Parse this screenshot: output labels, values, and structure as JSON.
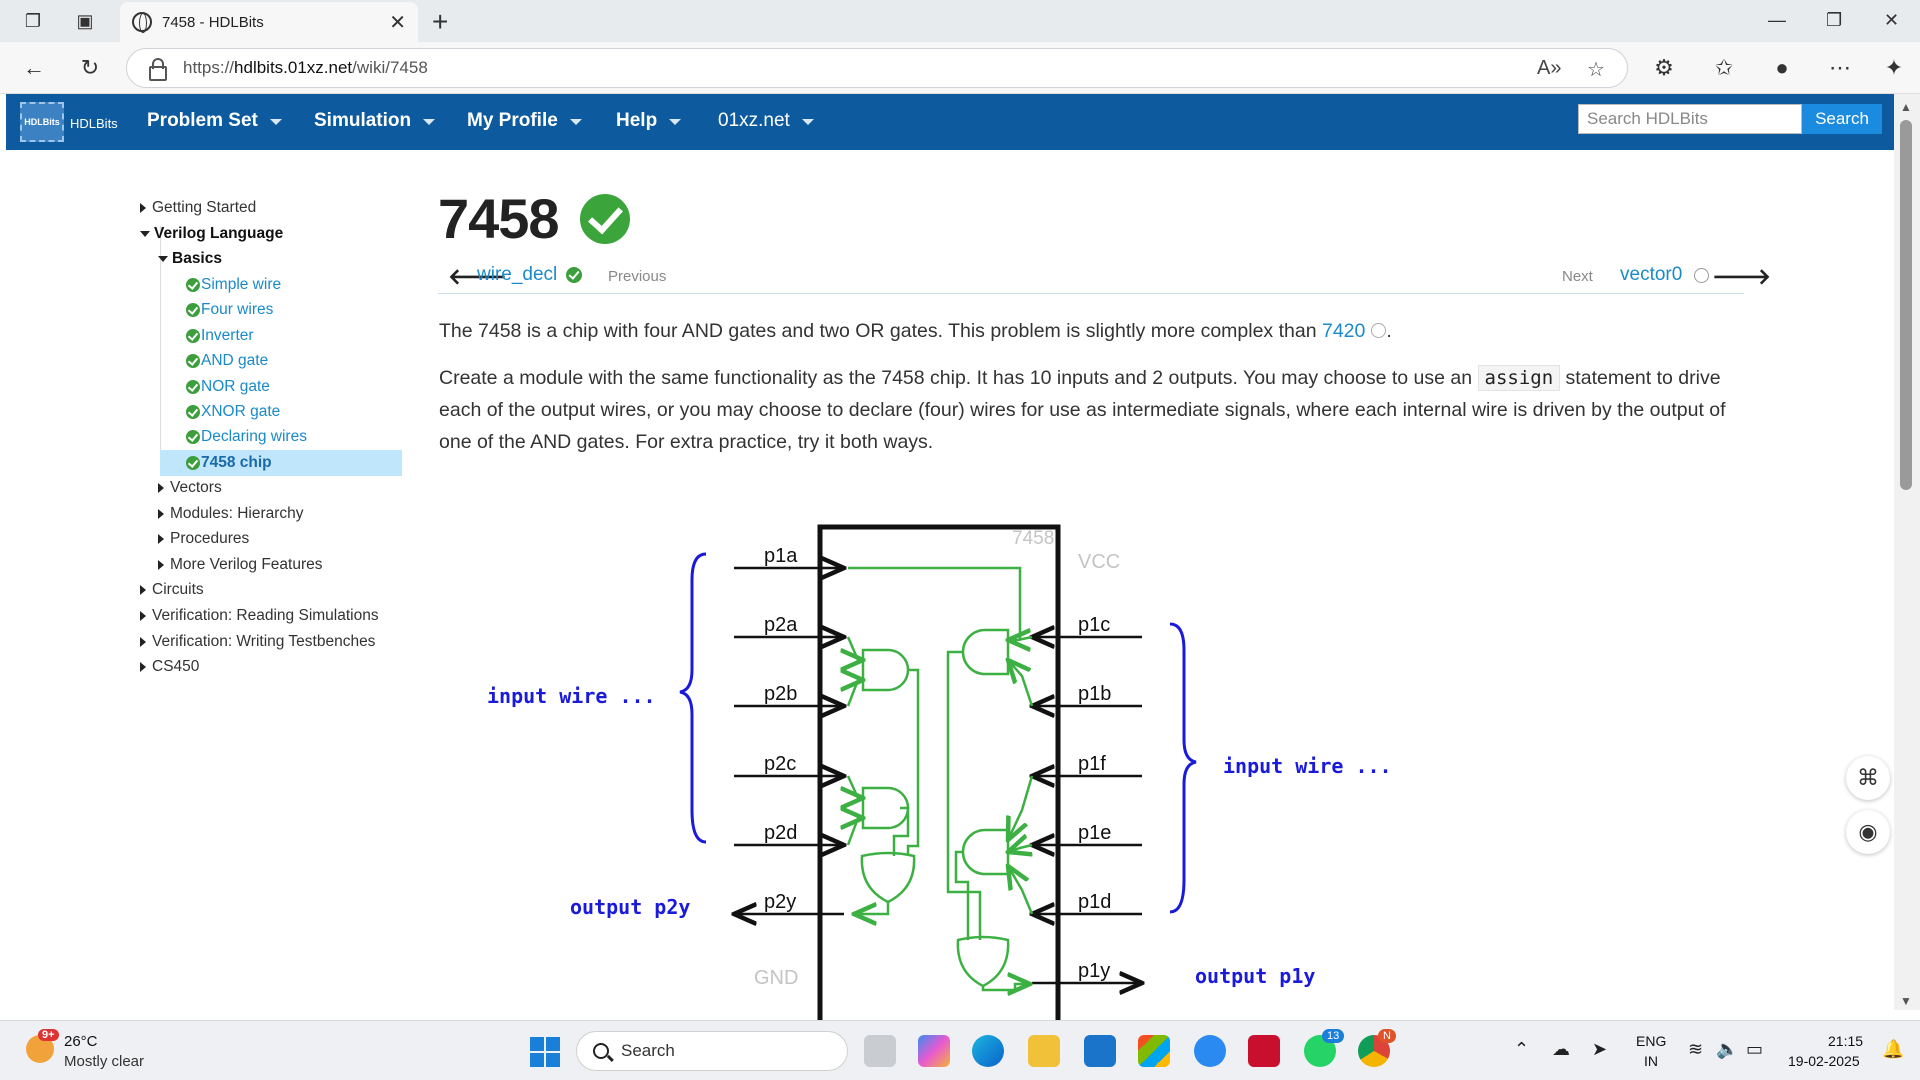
{
  "browser": {
    "tab_title": "7458 - HDLBits",
    "url_scheme": "https://",
    "url_host": "hdlbits.01xz.net",
    "url_path": "/wiki/7458"
  },
  "site": {
    "logo_mark": "HDLBits",
    "logo_text": "HDLBits",
    "nav": [
      "Problem Set",
      "Simulation",
      "My Profile",
      "Help",
      "01xz.net"
    ],
    "search_placeholder": "Search HDLBits",
    "search_button": "Search"
  },
  "sidebar": {
    "getting_started": "Getting Started",
    "verilog_language": "Verilog Language",
    "basics": "Basics",
    "basics_items": [
      "Simple wire",
      "Four wires",
      "Inverter",
      "AND gate",
      "NOR gate",
      "XNOR gate",
      "Declaring wires",
      "7458 chip"
    ],
    "sub_sections": [
      "Vectors",
      "Modules: Hierarchy",
      "Procedures",
      "More Verilog Features"
    ],
    "top_sections": [
      "Circuits",
      "Verification: Reading Simulations",
      "Verification: Writing Testbenches",
      "CS450"
    ]
  },
  "main": {
    "title": "7458",
    "prev_link": "wire_decl",
    "prev_label": "Previous",
    "next_label": "Next",
    "next_link": "vector0",
    "p1_text": "The 7458 is a chip with four AND gates and two OR gates. This problem is slightly more complex than ",
    "p1_link": "7420",
    "p1_end": ".",
    "p2_a": "Create a module with the same functionality as the 7458 chip. It has 10 inputs and 2 outputs. You may choose to use an ",
    "p2_code": "assign",
    "p2_b": " statement to drive each of the output wires, or you may choose to declare (four) wires for use as intermediate signals, where each internal wire is driven by the output of one of the AND gates. For extra practice, try it both ways."
  },
  "diagram": {
    "chip_label": "7458",
    "vcc": "VCC",
    "gnd": "GND",
    "left_pins": [
      "p1a",
      "p2a",
      "p2b",
      "p2c",
      "p2d",
      "p2y"
    ],
    "right_pins": [
      "p1c",
      "p1b",
      "p1f",
      "p1e",
      "p1d",
      "p1y"
    ],
    "input_label_left": "input wire ...",
    "input_label_right": "input wire ...",
    "output_left_prefix": "output",
    "output_left_name": "p2y",
    "output_right_prefix": "output",
    "output_right_name": "p1y"
  },
  "taskbar": {
    "weather_badge": "9+",
    "temp": "26°C",
    "weather": "Mostly clear",
    "search": "Search",
    "lang1": "ENG",
    "lang2": "IN",
    "time": "21:15",
    "date": "19-02-2025",
    "whatsapp_badge": "13",
    "chrome_badge": "N"
  },
  "colors": {
    "nav_bg": "#0d5b9e",
    "link": "#1a8ac9",
    "check_green": "#3ba53b",
    "wire_green": "#3cb043",
    "label_blue": "#1a1adb"
  }
}
